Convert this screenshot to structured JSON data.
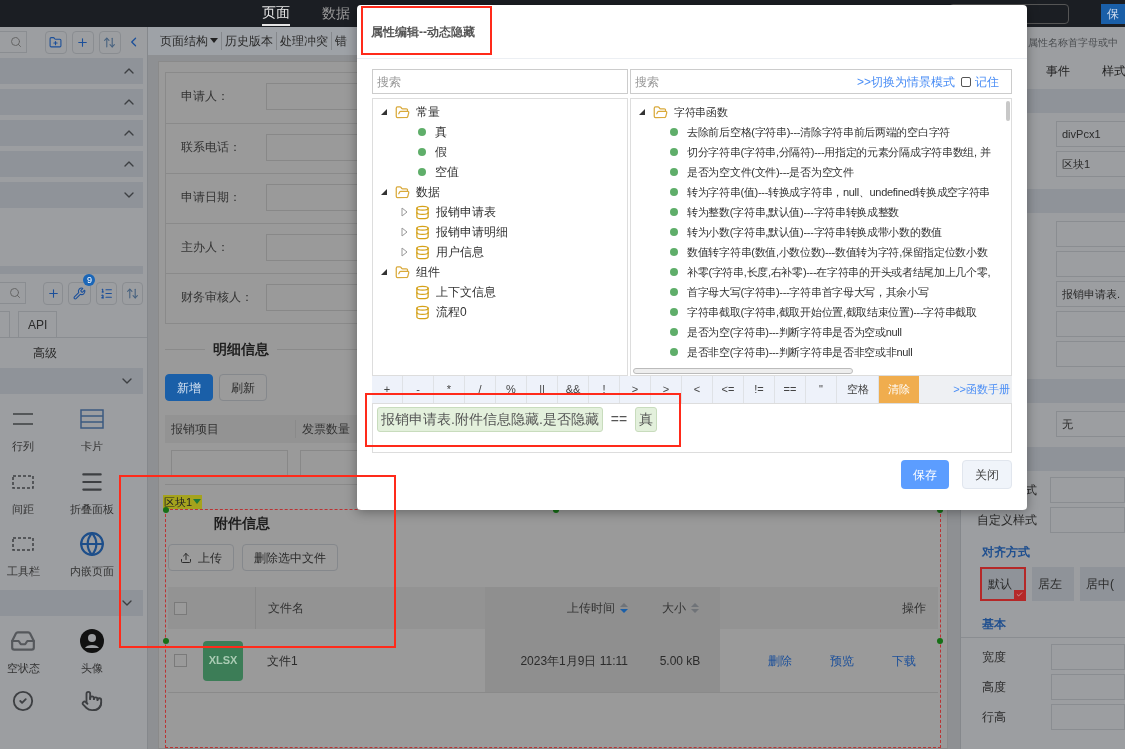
{
  "top_nav": {
    "tabs": [
      {
        "label": "页面",
        "selected": true
      },
      {
        "label": "数据",
        "selected": false
      }
    ],
    "save_button": "保"
  },
  "left_panel": {
    "outline_sections": [
      {
        "expanded": true
      },
      {
        "expanded": true
      },
      {
        "expanded": true
      },
      {
        "expanded": true
      },
      {
        "expanded": false
      }
    ],
    "tool_badge": "9",
    "tabs": [
      {
        "label": "API"
      }
    ],
    "subtabs": [
      {
        "label": "高级"
      }
    ],
    "component_groups": [
      {
        "expanded": false,
        "items": [
          {
            "label": "行列",
            "kind": "rows"
          },
          {
            "label": "卡片",
            "kind": "card"
          },
          {
            "label": "间距",
            "kind": "spacing"
          },
          {
            "label": "折叠面板",
            "kind": "collapse"
          },
          {
            "label": "工具栏",
            "kind": "toolbar"
          },
          {
            "label": "内嵌页面",
            "kind": "embed"
          }
        ]
      },
      {
        "expanded": false,
        "items": [
          {
            "label": "空状态",
            "kind": "empty"
          },
          {
            "label": "头像",
            "kind": "avatar"
          },
          {
            "kind": "check"
          },
          {
            "kind": "touch"
          }
        ]
      }
    ]
  },
  "center": {
    "toolbar": [
      {
        "label": "页面结构",
        "dropdown": true
      },
      {
        "label": "历史版本",
        "dropdown": false
      },
      {
        "label": "处理冲突",
        "dropdown": false
      },
      {
        "label": "错",
        "dropdown": false
      }
    ],
    "form_fields": [
      {
        "label": "申请人："
      },
      {
        "label": "联系电话："
      },
      {
        "label": "申请日期："
      },
      {
        "label": "主办人："
      },
      {
        "label": "财务审核人："
      }
    ],
    "detail": {
      "title": "明细信息",
      "buttons": [
        {
          "label": "新增",
          "kind": "primary"
        },
        {
          "label": "刷新",
          "kind": "default"
        }
      ],
      "columns": [
        "报销项目",
        "发票数量"
      ]
    },
    "block": {
      "tag": "区块1",
      "title": "附件信息",
      "buttons": [
        {
          "label": "上传",
          "kind": "upload"
        },
        {
          "label": "删除选中文件",
          "kind": "default"
        }
      ],
      "columns": [
        {
          "label": "文件名",
          "sortable": false
        },
        {
          "label": "上传时间",
          "sortable": true,
          "sort_active": true
        },
        {
          "label": "大小",
          "sortable": true,
          "sort_active": false
        },
        {
          "label": "操作",
          "sortable": false
        }
      ],
      "header_checked": false,
      "rows": [
        {
          "checked": false,
          "file_type": "XLSX",
          "name": "文件1",
          "time": "2023年1月9日 11:11",
          "size": "5.00 kB",
          "actions": [
            "删除",
            "预览",
            "下载"
          ]
        }
      ]
    }
  },
  "right_panel": {
    "search_placeholder": "属性名称首字母或中",
    "tabs": [
      {
        "label": "事件",
        "selected": false
      },
      {
        "label": "样式",
        "selected": false
      }
    ],
    "field_groups": [
      [
        {
          "kind": "text",
          "value": "divPcx1"
        },
        {
          "kind": "text",
          "value": "区块1"
        }
      ],
      [
        {
          "kind": "blank"
        },
        {
          "kind": "blank"
        },
        {
          "kind": "text",
          "value": "报销申请表."
        },
        {
          "kind": "blank"
        },
        {
          "kind": "blank"
        }
      ],
      [
        {
          "kind": "text",
          "value": "无"
        }
      ]
    ],
    "style_labels": [
      "式",
      "自定义样式"
    ],
    "align_heading": "对齐方式",
    "align_options": [
      {
        "label": "默认",
        "selected": true
      },
      {
        "label": "居左",
        "selected": false
      },
      {
        "label": "居中(",
        "selected": false
      }
    ],
    "basic_heading": "基本",
    "basic_fields": [
      "宽度",
      "高度",
      "行高"
    ]
  },
  "dialog": {
    "title": "属性编辑--动态隐藏",
    "left_search_placeholder": "搜索",
    "right_search_placeholder": "搜索",
    "mode_link": ">>切换为情景模式",
    "remember": {
      "label": "记住",
      "checked": false
    },
    "variable_tree": [
      {
        "label": "常量",
        "kind": "folder",
        "expanded": true,
        "children": [
          {
            "label": "真",
            "kind": "leaf"
          },
          {
            "label": "假",
            "kind": "leaf"
          },
          {
            "label": "空值",
            "kind": "leaf"
          }
        ]
      },
      {
        "label": "数据",
        "kind": "folder",
        "expanded": true,
        "children": [
          {
            "label": "报销申请表",
            "kind": "table",
            "expanded": false
          },
          {
            "label": "报销申请明细",
            "kind": "table",
            "expanded": false
          },
          {
            "label": "用户信息",
            "kind": "table",
            "expanded": false
          }
        ]
      },
      {
        "label": "组件",
        "kind": "folder",
        "expanded": true,
        "children": [
          {
            "label": "上下文信息",
            "kind": "table"
          },
          {
            "label": "流程0",
            "kind": "table"
          }
        ]
      }
    ],
    "function_tree": [
      {
        "label": "字符串函数",
        "kind": "folder",
        "expanded": true,
        "children": [
          {
            "label": "去除前后空格(字符串)---清除字符串前后两端的空白字符",
            "kind": "leaf"
          },
          {
            "label": "切分字符串(字符串,分隔符)---用指定的元素分隔成字符串数组, 并",
            "kind": "leaf"
          },
          {
            "label": "是否为空文件(文件)---是否为空文件",
            "kind": "leaf"
          },
          {
            "label": "转为字符串(值)---转换成字符串，null、undefined转换成空字符串",
            "kind": "leaf"
          },
          {
            "label": "转为整数(字符串,默认值)---字符串转换成整数",
            "kind": "leaf"
          },
          {
            "label": "转为小数(字符串,默认值)---字符串转换成带小数的数值",
            "kind": "leaf"
          },
          {
            "label": "数值转字符串(数值,小数位数)---数值转为字符,保留指定位数小数",
            "kind": "leaf"
          },
          {
            "label": "补零(字符串,长度,右补零)---在字符串的开头或者结尾加上几个零,",
            "kind": "leaf"
          },
          {
            "label": "首字母大写(字符串)---字符串首字母大写，其余小写",
            "kind": "leaf"
          },
          {
            "label": "字符串截取(字符串,截取开始位置,截取结束位置)---字符串截取",
            "kind": "leaf"
          },
          {
            "label": "是否为空(字符串)---判断字符串是否为空或null",
            "kind": "leaf"
          },
          {
            "label": "是否非空(字符串)---判断字符串是否非空或非null",
            "kind": "leaf"
          }
        ]
      }
    ],
    "operators": [
      "+",
      "-",
      "*",
      "/",
      "%",
      "||",
      "&&",
      "!",
      ">",
      ">",
      "<",
      "<=",
      "!=",
      "==",
      "\"",
      "空格"
    ],
    "clear_button": "清除",
    "manual_link": ">>函数手册",
    "expression": [
      {
        "kind": "token",
        "text": "报销申请表.附件信息隐藏.是否隐藏"
      },
      {
        "kind": "operator",
        "text": "=="
      },
      {
        "kind": "token",
        "text": "真"
      }
    ],
    "buttons": [
      {
        "label": "保存",
        "kind": "primary"
      },
      {
        "label": "关闭",
        "kind": "default"
      }
    ]
  }
}
